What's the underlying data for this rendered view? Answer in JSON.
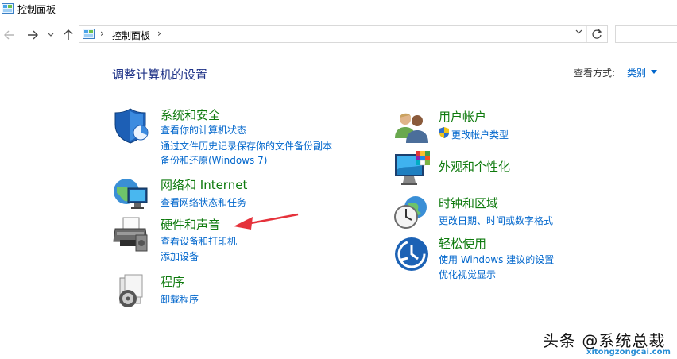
{
  "window": {
    "title": "控制面板"
  },
  "address": {
    "crumb": "控制面板",
    "sep1": "›",
    "sep2": "›"
  },
  "main": {
    "heading": "调整计算机的设置",
    "view_by_label": "查看方式:",
    "view_by_value": "类别",
    "left_categories": [
      {
        "title": "系统和安全",
        "icon": "shield-icon",
        "links": [
          "查看你的计算机状态",
          "通过文件历史记录保存你的文件备份副本",
          "备份和还原(Windows 7)"
        ]
      },
      {
        "title": "网络和 Internet",
        "icon": "network-globe-icon",
        "links": [
          "查看网络状态和任务"
        ]
      },
      {
        "title": "硬件和声音",
        "icon": "printer-icon",
        "links": [
          "查看设备和打印机",
          "添加设备"
        ]
      },
      {
        "title": "程序",
        "icon": "programs-disc-icon",
        "links": [
          "卸载程序"
        ]
      }
    ],
    "right_categories": [
      {
        "title": "用户帐户",
        "icon": "users-icon",
        "links": [
          "更改帐户类型"
        ]
      },
      {
        "title": "外观和个性化",
        "icon": "monitor-color-icon",
        "links": []
      },
      {
        "title": "时钟和区域",
        "icon": "clock-globe-icon",
        "links": [
          "更改日期、时间或数字格式"
        ]
      },
      {
        "title": "轻松使用",
        "icon": "ease-of-access-icon",
        "links": [
          "使用 Windows 建议的设置",
          "优化视觉显示"
        ]
      }
    ]
  },
  "watermark": {
    "main": "头条 @系统总裁",
    "sub": "xitongzongcai.com"
  },
  "colors": {
    "heading": "#1e3287",
    "category": "#0e7a0d",
    "link": "#0066cc",
    "arrow": "#e5323b"
  }
}
